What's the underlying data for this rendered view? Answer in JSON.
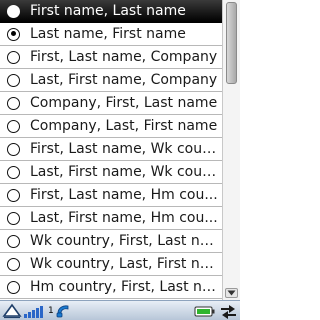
{
  "list": {
    "items": [
      {
        "label": "First name, Last name",
        "checked": false,
        "highlighted": true
      },
      {
        "label": "Last name, First name",
        "checked": true,
        "highlighted": false
      },
      {
        "label": "First, Last name, Company",
        "checked": false,
        "highlighted": false
      },
      {
        "label": "Last, First name, Company",
        "checked": false,
        "highlighted": false
      },
      {
        "label": "Company, First, Last name",
        "checked": false,
        "highlighted": false
      },
      {
        "label": "Company, Last, First name",
        "checked": false,
        "highlighted": false
      },
      {
        "label": "First, Last name, Wk coun...",
        "checked": false,
        "highlighted": false
      },
      {
        "label": "Last, First name, Wk coun...",
        "checked": false,
        "highlighted": false
      },
      {
        "label": "First, Last name, Hm cou...",
        "checked": false,
        "highlighted": false
      },
      {
        "label": "Last, First name, Hm cou...",
        "checked": false,
        "highlighted": false
      },
      {
        "label": "Wk country, First, Last na...",
        "checked": false,
        "highlighted": false
      },
      {
        "label": "Wk country, Last, First na...",
        "checked": false,
        "highlighted": false
      },
      {
        "label": "Hm country, First, Last na...",
        "checked": false,
        "highlighted": false
      }
    ]
  },
  "status_bar": {
    "signal_count": "1",
    "icons": [
      "home-triangle-icon",
      "signal-bars-icon",
      "phone-handset-icon",
      "battery-icon",
      "transfer-arrows-icon"
    ]
  },
  "colors": {
    "highlight": "#000000",
    "status_bar": "#c9d6e6",
    "battery": "#2fb52f"
  }
}
